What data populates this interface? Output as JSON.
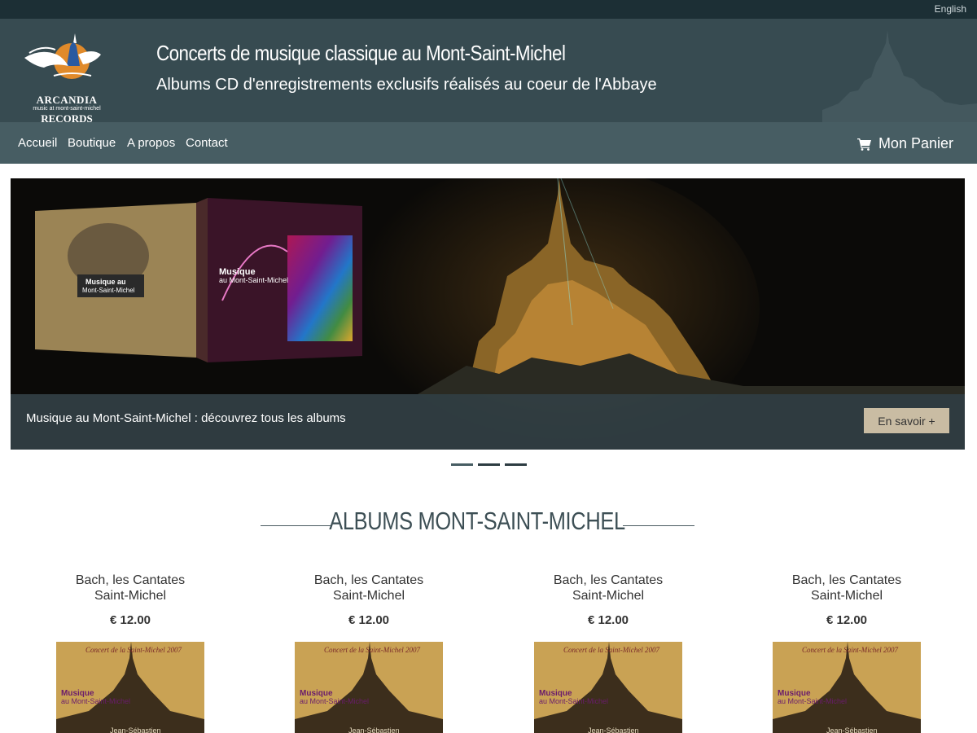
{
  "topbar": {
    "language_link": "English"
  },
  "header": {
    "logo_line1": "ARCANDIA",
    "logo_line2": "music at mont-saint-michel",
    "logo_line3": "RECORDS",
    "title": "Concerts de musique classique au Mont-Saint-Michel",
    "subtitle": "Albums CD d'enregistrements exclusifs réalisés au coeur de l'Abbaye"
  },
  "nav": {
    "items": [
      {
        "label": "Accueil"
      },
      {
        "label": "Boutique"
      },
      {
        "label": "A propos"
      },
      {
        "label": "Contact"
      }
    ],
    "cart_label": "Mon Panier",
    "cart_icon": "shopping-cart-icon"
  },
  "slider": {
    "caption": "Musique au Mont-Saint-Michel : découvrez tous les albums",
    "button_label": "En savoir +",
    "album1_title": "Musique au Mont-Saint-Michel",
    "album2_title_line1": "Musique",
    "album2_title_line2": "au Mont-Saint-Michel",
    "slide_count": 3,
    "active_slide": 1
  },
  "section": {
    "title": "ALBUMS MONT-SAINT-MICHEL"
  },
  "products": [
    {
      "title_line1": "Bach, les Cantates",
      "title_line2": "Saint-Michel",
      "price": "€ 12.00",
      "cover_header": "Concert de la Saint-Michel 2007",
      "cover_title1": "Musique",
      "cover_title2": "au Mont-Saint-Michel",
      "cover_composer": "Jean-Sébastien"
    },
    {
      "title_line1": "Bach, les Cantates",
      "title_line2": "Saint-Michel",
      "price": "€ 12.00",
      "cover_header": "Concert de la Saint-Michel 2007",
      "cover_title1": "Musique",
      "cover_title2": "au Mont-Saint-Michel",
      "cover_composer": "Jean-Sébastien"
    },
    {
      "title_line1": "Bach, les Cantates",
      "title_line2": "Saint-Michel",
      "price": "€ 12.00",
      "cover_header": "Concert de la Saint-Michel 2007",
      "cover_title1": "Musique",
      "cover_title2": "au Mont-Saint-Michel",
      "cover_composer": "Jean-Sébastien"
    },
    {
      "title_line1": "Bach, les Cantates",
      "title_line2": "Saint-Michel",
      "price": "€ 12.00",
      "cover_header": "Concert de la Saint-Michel 2007",
      "cover_title1": "Musique",
      "cover_title2": "au Mont-Saint-Michel",
      "cover_composer": "Jean-Sébastien"
    }
  ],
  "colors": {
    "topbar": "#1c2f35",
    "header": "#374b51",
    "nav": "#475d63",
    "button": "#c9bca3",
    "cover_gold": "#c9a254"
  }
}
